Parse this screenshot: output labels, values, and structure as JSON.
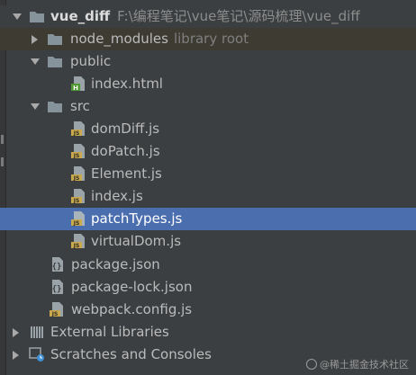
{
  "project": {
    "name": "vue_diff",
    "path": "F:\\编程笔记\\vue笔记\\源码梳理\\vue_diff"
  },
  "node_modules": {
    "label": "node_modules",
    "hint": "library root"
  },
  "public": {
    "label": "public",
    "files": [
      "index.html"
    ]
  },
  "src": {
    "label": "src",
    "files": [
      "domDiff.js",
      "doPatch.js",
      "Element.js",
      "index.js",
      "patchTypes.js",
      "virtualDom.js"
    ]
  },
  "root_files": [
    "package.json",
    "package-lock.json",
    "webpack.config.js"
  ],
  "external_libraries": "External Libraries",
  "scratches": "Scratches and Consoles",
  "watermark": "@稀土掘金技术社区",
  "colors": {
    "background": "#3c3f41",
    "selection": "#4b6eaf",
    "folder": "#87939a",
    "js_badge": "#c9a94b",
    "html_badge": "#4e9a32"
  }
}
